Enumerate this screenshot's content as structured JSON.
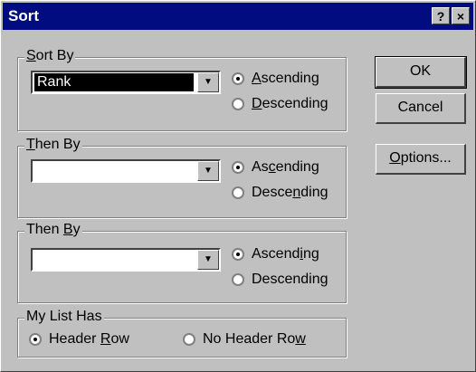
{
  "window": {
    "title": "Sort",
    "help_label": "?",
    "close_label": "×"
  },
  "sort_by": {
    "legend": "Sort By",
    "value": "Rank",
    "ascending_label": "Ascending",
    "descending_label": "Descending",
    "selected": "ascending"
  },
  "then_by_1": {
    "legend": "Then By",
    "value": "",
    "ascending_label": "Ascending",
    "descending_label": "Descending",
    "selected": "ascending"
  },
  "then_by_2": {
    "legend": "Then By",
    "value": "",
    "ascending_label": "Ascending",
    "descending_label": "Descending",
    "selected": "ascending"
  },
  "list_has": {
    "legend": "My List Has",
    "header_row_label": "Header Row",
    "no_header_row_label": "No Header Row",
    "selected": "header_row"
  },
  "buttons": {
    "ok": "OK",
    "cancel": "Cancel",
    "options": "Options..."
  }
}
